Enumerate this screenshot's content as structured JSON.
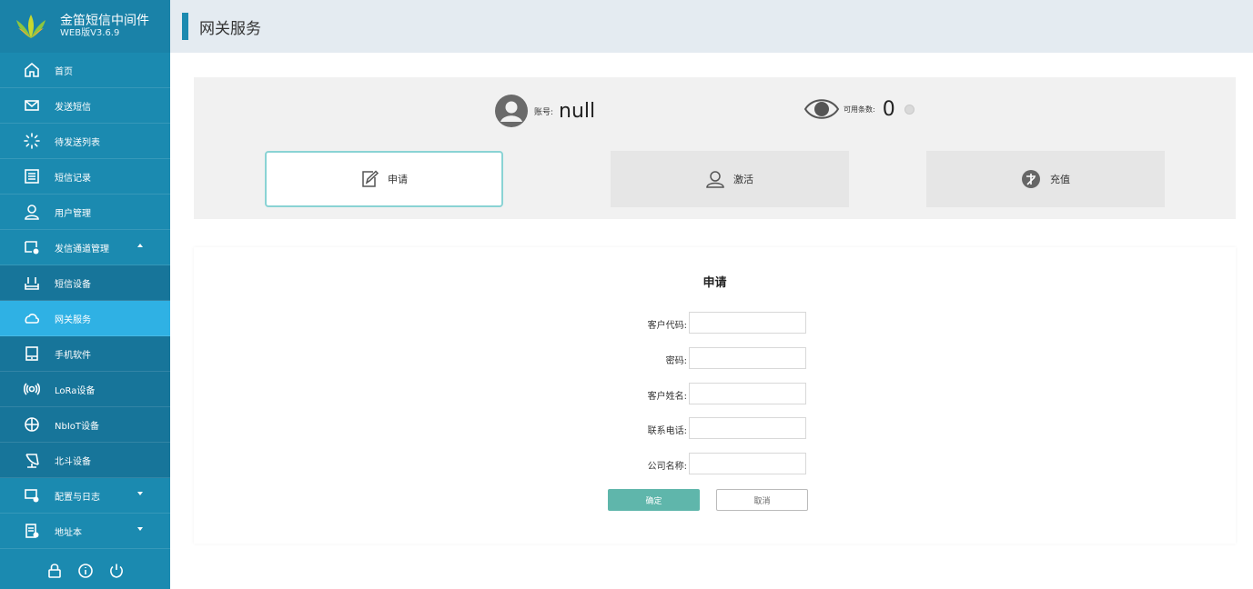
{
  "brand": {
    "title": "金笛短信中间件",
    "version": "WEB版V3.6.9"
  },
  "header": {
    "title": "网关服务"
  },
  "sidebar": {
    "items": [
      {
        "label": "首页",
        "icon": "home-icon"
      },
      {
        "label": "发送短信",
        "icon": "mail-icon"
      },
      {
        "label": "待发送列表",
        "icon": "loading-icon"
      },
      {
        "label": "短信记录",
        "icon": "records-icon"
      },
      {
        "label": "用户管理",
        "icon": "user-icon"
      },
      {
        "label": "发信通道管理",
        "icon": "channel-settings-icon"
      },
      {
        "label": "短信设备",
        "icon": "router-icon"
      },
      {
        "label": "网关服务",
        "icon": "cloud-icon"
      },
      {
        "label": "手机软件",
        "icon": "phone-icon"
      },
      {
        "label": "LoRa设备",
        "icon": "wireless-icon"
      },
      {
        "label": "NbIoT设备",
        "icon": "globe-icon"
      },
      {
        "label": "北斗设备",
        "icon": "satellite-icon"
      },
      {
        "label": "配置与日志",
        "icon": "config-icon"
      },
      {
        "label": "地址本",
        "icon": "address-book-icon"
      }
    ],
    "footer_icons": [
      "lock-icon",
      "info-icon",
      "power-icon"
    ]
  },
  "account": {
    "label": "账号:",
    "value": "null"
  },
  "available": {
    "label": "可用条数:",
    "value": "0"
  },
  "tabs": [
    {
      "label": "申请",
      "icon": "edit-icon",
      "active": true
    },
    {
      "label": "激活",
      "icon": "user-icon",
      "active": false
    },
    {
      "label": "充值",
      "icon": "recharge-icon",
      "active": false
    }
  ],
  "form": {
    "title": "申请",
    "fields": [
      {
        "label": "客户代码:",
        "value": ""
      },
      {
        "label": "密码:",
        "value": ""
      },
      {
        "label": "客户姓名:",
        "value": ""
      },
      {
        "label": "联系电话:",
        "value": ""
      },
      {
        "label": "公司名称:",
        "value": ""
      }
    ],
    "ok_label": "确定",
    "cancel_label": "取消"
  },
  "colors": {
    "sidebar": "#1b8ab0",
    "sidebar_active": "#2fb1e4",
    "header_bg": "#e4ebf1",
    "ok_button": "#5fb6ab",
    "tab_active_border": "#8ad3d4"
  }
}
